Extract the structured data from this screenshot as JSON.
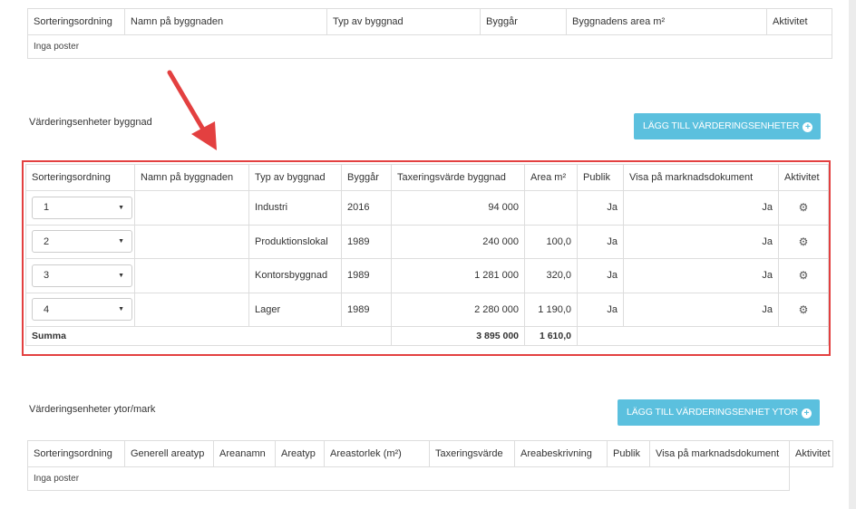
{
  "top_table": {
    "headers": [
      "Sorteringsordning",
      "Namn på byggnaden",
      "Typ av byggnad",
      "Byggår",
      "Byggnadens area m²",
      "Aktivitet"
    ],
    "empty_text": "Inga poster"
  },
  "building_section": {
    "title": "Värderingsenheter byggnad",
    "add_button_label": "LÄGG TILL VÄRDERINGSENHETER",
    "headers": [
      "Sorteringsordning",
      "Namn på byggnaden",
      "Typ av byggnad",
      "Byggår",
      "Taxeringsvärde byggnad",
      "Area m²",
      "Publik",
      "Visa på marknadsdokument",
      "Aktivitet"
    ],
    "rows": [
      {
        "order": "1",
        "name": "",
        "type": "Industri",
        "year": "2016",
        "value": "94 000",
        "area": "",
        "public": "Ja",
        "show_market": "Ja"
      },
      {
        "order": "2",
        "name": "",
        "type": "Produktionslokal",
        "year": "1989",
        "value": "240 000",
        "area": "100,0",
        "public": "Ja",
        "show_market": "Ja"
      },
      {
        "order": "3",
        "name": "",
        "type": "Kontorsbyggnad",
        "year": "1989",
        "value": "1 281 000",
        "area": "320,0",
        "public": "Ja",
        "show_market": "Ja"
      },
      {
        "order": "4",
        "name": "",
        "type": "Lager",
        "year": "1989",
        "value": "2 280 000",
        "area": "1 190,0",
        "public": "Ja",
        "show_market": "Ja"
      }
    ],
    "sum_label": "Summa",
    "sum_value": "3 895 000",
    "sum_area": "1 610,0"
  },
  "land_section": {
    "title": "Värderingsenheter ytor/mark",
    "add_button_label": "LÄGG TILL VÄRDERINGSENHET YTOR",
    "headers": [
      "Sorteringsordning",
      "Generell areatyp",
      "Areanamn",
      "Areatyp",
      "Areastorlek (m²)",
      "Taxeringsvärde",
      "Areabeskrivning",
      "Publik",
      "Visa på marknadsdokument",
      "Aktivitet"
    ],
    "empty_text": "Inga poster"
  },
  "icons": {
    "gear": "gear-icon",
    "plus": "plus-circle-icon",
    "caret": "caret-down-icon",
    "arrow": "annotation-arrow"
  },
  "colors": {
    "button": "#5bc0de",
    "highlight": "#e34040"
  }
}
